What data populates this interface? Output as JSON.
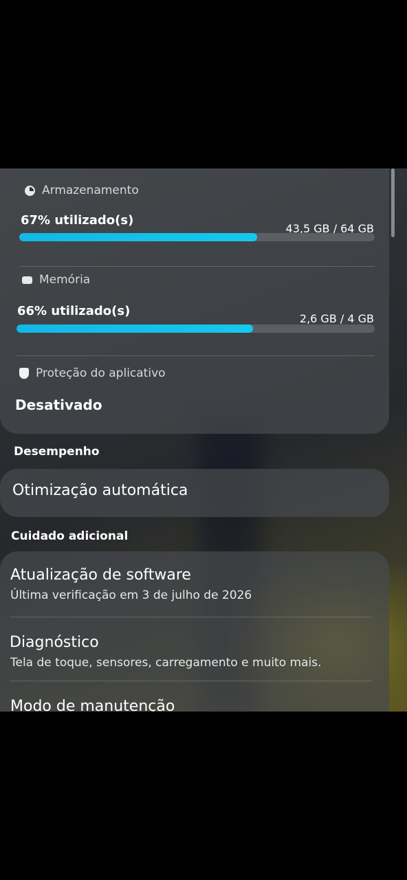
{
  "storage": {
    "title": "Armazenamento",
    "used_label": "67% utilizado(s)",
    "used_value": "43,5 GB / 64 GB",
    "fill_fraction": 0.67,
    "icon": "storage-pie-icon"
  },
  "memory": {
    "title": "Memória",
    "used_label": "66% utilizado(s)",
    "used_value": "2,6 GB / 4 GB",
    "fill_fraction": 0.66,
    "icon": "memory-chip-icon"
  },
  "app_protection": {
    "title": "Proteção do aplicativo",
    "status": "Desativado",
    "icon": "shield-icon"
  },
  "performance": {
    "header": "Desempenho",
    "items": [
      {
        "title": "Otimização automática"
      }
    ]
  },
  "additional_care": {
    "header": "Cuidado adicional",
    "items": [
      {
        "title": "Atualização de software",
        "subtitle": "Última verificação em 3 de julho de 2026"
      },
      {
        "title": "Diagnóstico",
        "subtitle": "Tela de toque, sensores, carregamento e muito mais."
      },
      {
        "title": "Modo de manutenção",
        "subtitle": ""
      }
    ]
  },
  "colors": {
    "progress_fill": "#12b8e6",
    "progress_track": "#5b5f63",
    "background": "#000000"
  }
}
